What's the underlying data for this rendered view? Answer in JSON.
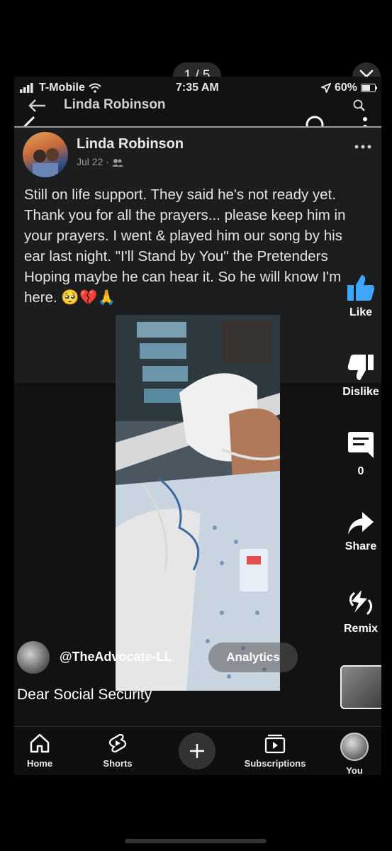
{
  "viewer": {
    "counter": "1 / 5"
  },
  "status_bar": {
    "carrier": "T-Mobile",
    "time": "7:35 AM",
    "battery": "60%"
  },
  "facebook": {
    "header_name": "Linda Robinson"
  },
  "post": {
    "author": "Linda Robinson",
    "date": "Jul 22 ·",
    "text": "Still on life support. They said he's not ready yet. Thank you for all the prayers... please keep him in your prayers. I went & played him our song by his ear last night. \"I'll Stand by You\" the Pretenders Hoping maybe he can hear it. So he will know I'm here. 🥺💔🙏"
  },
  "actions": {
    "like": "Like",
    "dislike": "Dislike",
    "comments": "0",
    "share": "Share",
    "remix": "Remix"
  },
  "channel": {
    "handle": "@TheAdvocate-LL",
    "analytics": "Analytics"
  },
  "video_title": "Dear Social Security",
  "nav": {
    "home": "Home",
    "shorts": "Shorts",
    "subscriptions": "Subscriptions",
    "you": "You"
  },
  "colors": {
    "accent_blue": "#3ea6ff",
    "background": "#000000"
  }
}
